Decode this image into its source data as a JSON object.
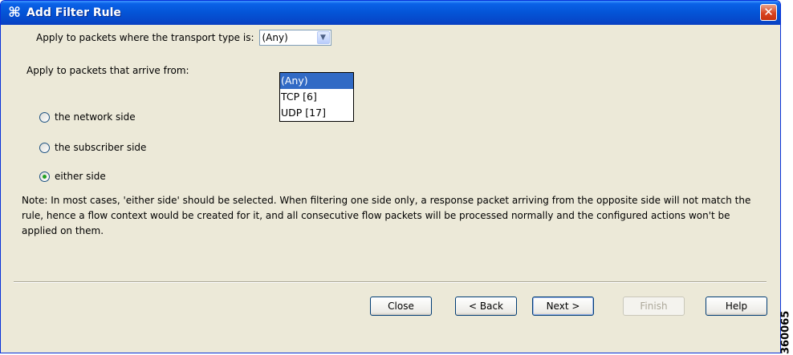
{
  "window": {
    "title": "Add Filter Rule",
    "icon": "cisco-sce-icon",
    "close_label": "✕"
  },
  "transport": {
    "label": "Apply to packets where the transport type is:",
    "selected": "(Any)",
    "options": [
      "(Any)",
      "TCP [6]",
      "UDP [17]"
    ]
  },
  "arrive": {
    "label": "Apply to packets that arrive from:",
    "options": [
      {
        "label": "the network side",
        "checked": false
      },
      {
        "label": "the subscriber side",
        "checked": false
      },
      {
        "label": "either side",
        "checked": true
      }
    ]
  },
  "note": "Note: In most cases, 'either side' should be selected. When filtering one side only, a response packet arriving from the opposite side will not match the rule, hence a flow context would be created for it, and all consecutive flow packets will be processed normally and the configured actions won't be applied on them.",
  "buttons": {
    "close": "Close",
    "back": "< Back",
    "next": "Next >",
    "finish": "Finish",
    "help": "Help"
  },
  "figure_id": "360065",
  "colors": {
    "titlebar": "#0454d6",
    "dialog_bg": "#ece9d8",
    "selection": "#316ac5",
    "close_button": "#d9431f"
  }
}
